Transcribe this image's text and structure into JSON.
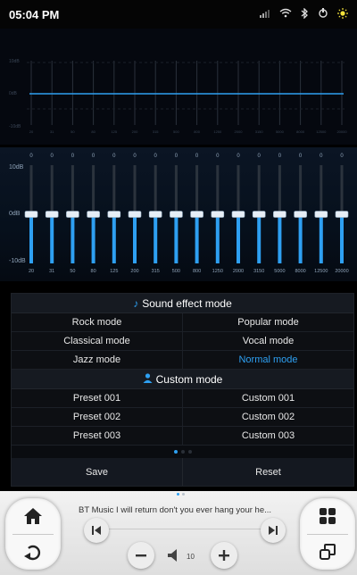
{
  "status_bar": {
    "time": "05:04 PM",
    "icons": [
      "signal-icon",
      "wifi-icon",
      "bluetooth-icon",
      "usb-icon",
      "brightness-icon"
    ]
  },
  "graph": {
    "db_top": "10dB",
    "db_mid": "0dB",
    "db_bottom": "-10dB",
    "line_color": "#2ea0f2"
  },
  "equalizer": {
    "db_top": "10dB",
    "db_mid": "0dB",
    "db_bottom": "-10dB",
    "bands": [
      {
        "freq": "20",
        "value": "0"
      },
      {
        "freq": "31",
        "value": "0"
      },
      {
        "freq": "50",
        "value": "0"
      },
      {
        "freq": "80",
        "value": "0"
      },
      {
        "freq": "125",
        "value": "0"
      },
      {
        "freq": "200",
        "value": "0"
      },
      {
        "freq": "315",
        "value": "0"
      },
      {
        "freq": "500",
        "value": "0"
      },
      {
        "freq": "800",
        "value": "0"
      },
      {
        "freq": "1250",
        "value": "0"
      },
      {
        "freq": "2000",
        "value": "0"
      },
      {
        "freq": "3150",
        "value": "0"
      },
      {
        "freq": "5000",
        "value": "0"
      },
      {
        "freq": "8000",
        "value": "0"
      },
      {
        "freq": "12500",
        "value": "0"
      },
      {
        "freq": "20000",
        "value": "0"
      }
    ]
  },
  "sound_effect": {
    "header": "Sound effect mode",
    "rows": [
      [
        "Rock mode",
        "Popular mode"
      ],
      [
        "Classical mode",
        "Vocal mode"
      ],
      [
        "Jazz mode",
        "Normal mode"
      ]
    ],
    "active": "Normal mode"
  },
  "custom": {
    "header": "Custom mode",
    "rows": [
      [
        "Preset 001",
        "Custom 001"
      ],
      [
        "Preset 002",
        "Custom 002"
      ],
      [
        "Preset 003",
        "Custom 003"
      ]
    ]
  },
  "actions": {
    "save": "Save",
    "reset": "Reset"
  },
  "dock": {
    "track": "BT Music   I will return don't you ever hang your he...",
    "volume": "10",
    "accent": "#2ea0f2"
  }
}
